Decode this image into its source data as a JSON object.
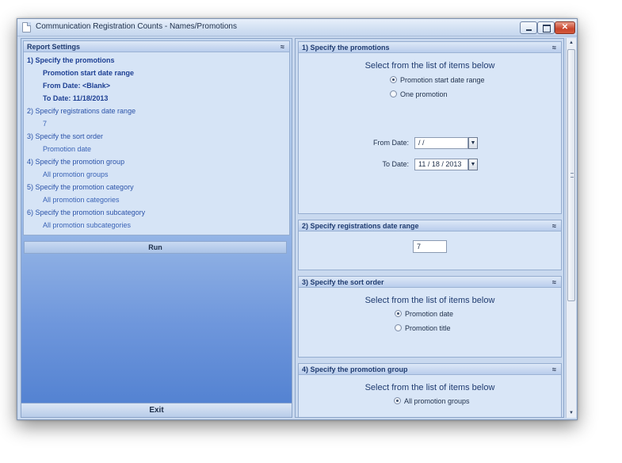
{
  "window": {
    "title": "Communication Registration Counts - Names/Promotions",
    "controls": {
      "minimize": "",
      "maximize": "",
      "close": "✕"
    }
  },
  "report_settings": {
    "header": "Report Settings",
    "collapse_glyph": "≈",
    "rows": [
      {
        "text": "1)  Specify the promotions",
        "kind": "step",
        "active": true
      },
      {
        "text": "Promotion start date range",
        "kind": "sub",
        "active": true
      },
      {
        "text": "From Date:  <Blank>",
        "kind": "sub",
        "active": true
      },
      {
        "text": "To Date:  11/18/2013",
        "kind": "sub",
        "active": true
      },
      {
        "text": "2)  Specify registrations date range",
        "kind": "step",
        "active": false
      },
      {
        "text": "7",
        "kind": "sub",
        "active": false
      },
      {
        "text": "3)  Specify the sort order",
        "kind": "step",
        "active": false
      },
      {
        "text": "Promotion date",
        "kind": "sub",
        "active": false
      },
      {
        "text": "4)  Specify the promotion group",
        "kind": "step",
        "active": false
      },
      {
        "text": "All promotion groups",
        "kind": "sub",
        "active": false
      },
      {
        "text": "5)  Specify the promotion category",
        "kind": "step",
        "active": false
      },
      {
        "text": "All promotion categories",
        "kind": "sub",
        "active": false
      },
      {
        "text": "6)  Specify the promotion subcategory",
        "kind": "step",
        "active": false
      },
      {
        "text": "All promotion subcategories",
        "kind": "sub",
        "active": false
      }
    ],
    "run_label": "Run",
    "exit_label": "Exit"
  },
  "sections": {
    "promotions": {
      "header": "1)  Specify the promotions",
      "collapse_glyph": "≈",
      "instruction": "Select from the list of items below",
      "options": [
        {
          "label": "Promotion start date range",
          "selected": true
        },
        {
          "label": "One promotion",
          "selected": false
        }
      ],
      "from_label": "From Date:",
      "from_value": "   /    /",
      "to_label": "To Date:",
      "to_value": "11 / 18 / 2013",
      "dropdown_glyph": "▼"
    },
    "registrations": {
      "header": "2)  Specify registrations date range",
      "collapse_glyph": "≈",
      "value": "7"
    },
    "sort_order": {
      "header": "3)  Specify the sort order",
      "collapse_glyph": "≈",
      "instruction": "Select from the list of items below",
      "options": [
        {
          "label": "Promotion date",
          "selected": true
        },
        {
          "label": "Promotion title",
          "selected": false
        }
      ]
    },
    "promotion_group": {
      "header": "4)  Specify the promotion group",
      "collapse_glyph": "≈",
      "instruction": "Select from the list of items below",
      "options": [
        {
          "label": "All promotion groups",
          "selected": true
        }
      ]
    }
  },
  "scrollbar": {
    "up_glyph": "▲",
    "down_glyph": "▼"
  }
}
